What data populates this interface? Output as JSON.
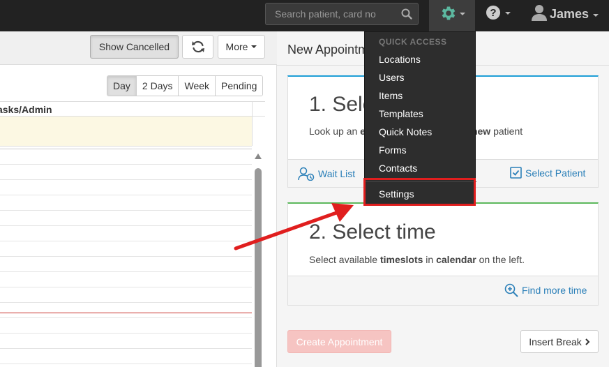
{
  "navbar": {
    "search_placeholder": "Search patient, card no",
    "user_name": "James"
  },
  "left": {
    "show_cancelled_label": "Show Cancelled",
    "more_label": "More",
    "views": [
      "Day",
      "2 Days",
      "Week",
      "Pending"
    ],
    "column_header": "asks/Admin"
  },
  "right": {
    "title": "New Appointm",
    "step1": {
      "heading": "1. Sele",
      "text_pre": "Look up an ",
      "text_bold1": "e",
      "text_bold2": "new",
      "text_post": " patient",
      "wait_list_label": "Wait List",
      "select_patient_label": "Select Patient"
    },
    "step2": {
      "heading": "2. Select time",
      "text_1": "Select available ",
      "text_bold1": "timeslots",
      "text_2": " in ",
      "text_bold2": "calendar",
      "text_3": " on the left.",
      "find_more_label": "Find more time"
    },
    "create_label": "Create Appointment",
    "insert_break_label": "Insert Break"
  },
  "dropdown": {
    "header": "QUICK ACCESS",
    "items": [
      "Locations",
      "Users",
      "Items",
      "Templates",
      "Quick Notes",
      "Forms",
      "Contacts"
    ],
    "settings_label": "Settings"
  },
  "colors": {
    "navbar": "#222222",
    "accent_blue": "#1e9ed6",
    "accent_green": "#5cb85c",
    "gear_green": "#5cb8a0",
    "highlight_red": "#e01e1e"
  },
  "icons": [
    "search-icon",
    "gear-icon",
    "help-icon",
    "user-icon",
    "refresh-icon",
    "wait-list-icon",
    "checkbox-icon",
    "zoom-in-icon",
    "chevron-right-icon",
    "arrow-annotation"
  ]
}
